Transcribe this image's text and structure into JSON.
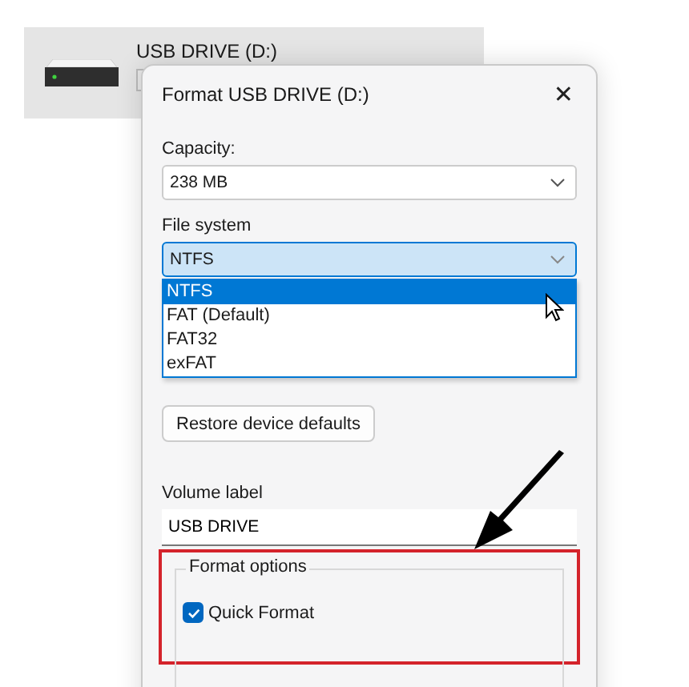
{
  "drive_tile": {
    "name": "USB DRIVE (D:)"
  },
  "dialog": {
    "title": "Format USB DRIVE (D:)",
    "close": "✕"
  },
  "capacity": {
    "label": "Capacity:",
    "value": "238 MB"
  },
  "file_system": {
    "label": "File system",
    "value": "NTFS",
    "expanded": true,
    "options": [
      {
        "label": "NTFS",
        "selected": true
      },
      {
        "label": "FAT (Default)",
        "selected": false
      },
      {
        "label": "FAT32",
        "selected": false
      },
      {
        "label": "exFAT",
        "selected": false
      }
    ]
  },
  "restore_button": "Restore device defaults",
  "volume_label": {
    "label": "Volume label",
    "value": "USB DRIVE"
  },
  "format_options": {
    "title": "Format options",
    "highlighted": true,
    "quick_format": {
      "label": "Quick Format",
      "checked": true
    }
  }
}
